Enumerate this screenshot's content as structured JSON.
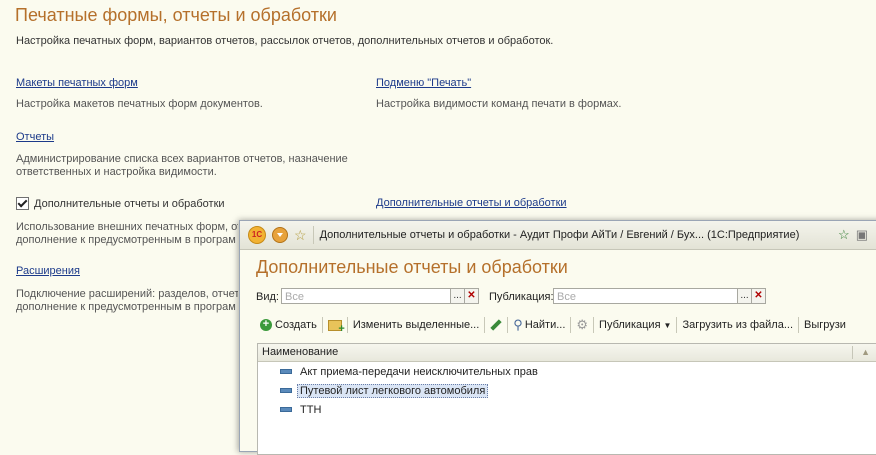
{
  "page": {
    "title": "Печатные формы, отчеты и обработки",
    "subtitle": "Настройка печатных форм, вариантов отчетов, рассылок отчетов, дополнительных отчетов и обработок."
  },
  "sections": {
    "makety": {
      "link": "Макеты печатных форм",
      "desc": "Настройка макетов печатных форм документов."
    },
    "podmenu": {
      "link": "Подменю \"Печать\"",
      "desc": "Настройка видимости команд печати в формах."
    },
    "otchety": {
      "link": "Отчеты",
      "desc1": "Администрирование списка всех вариантов отчетов, назначение",
      "desc2": "ответственных и настройка видимости."
    },
    "dop_checkbox": {
      "label": "Дополнительные отчеты и обработки",
      "checked": true,
      "desc1": "Использование внешних печатных форм, от",
      "desc2": "дополнение к предусмотренным в програм"
    },
    "dop_link": {
      "link": "Дополнительные отчеты и обработки"
    },
    "rasshireniya": {
      "link": "Расширения",
      "desc1": "Подключение расширений: разделов, отчет",
      "desc2": "дополнение к предусмотренным в програм"
    }
  },
  "window": {
    "title": "Дополнительные отчеты и обработки - Аудит Профи АйТи / Евгений / Бух...  (1С:Предприятие)",
    "heading": "Дополнительные отчеты и обработки",
    "filters": {
      "vid_label": "Вид:",
      "vid_placeholder": "Все",
      "pub_label": "Публикация:",
      "pub_placeholder": "Все",
      "select_btn": "...",
      "clear_btn": "✕"
    },
    "toolbar": {
      "create": "Создать",
      "change_selected": "Изменить выделенные...",
      "find": "Найти...",
      "publication": "Публикация",
      "load_from_file": "Загрузить из файла...",
      "unload": "Выгрузи"
    },
    "table": {
      "column": "Наименование",
      "rows": [
        {
          "name": "Акт приема-передачи неисключительных прав"
        },
        {
          "name": "Путевой лист легкового автомобиля",
          "selected": true
        },
        {
          "name": "ТТН"
        }
      ]
    }
  }
}
